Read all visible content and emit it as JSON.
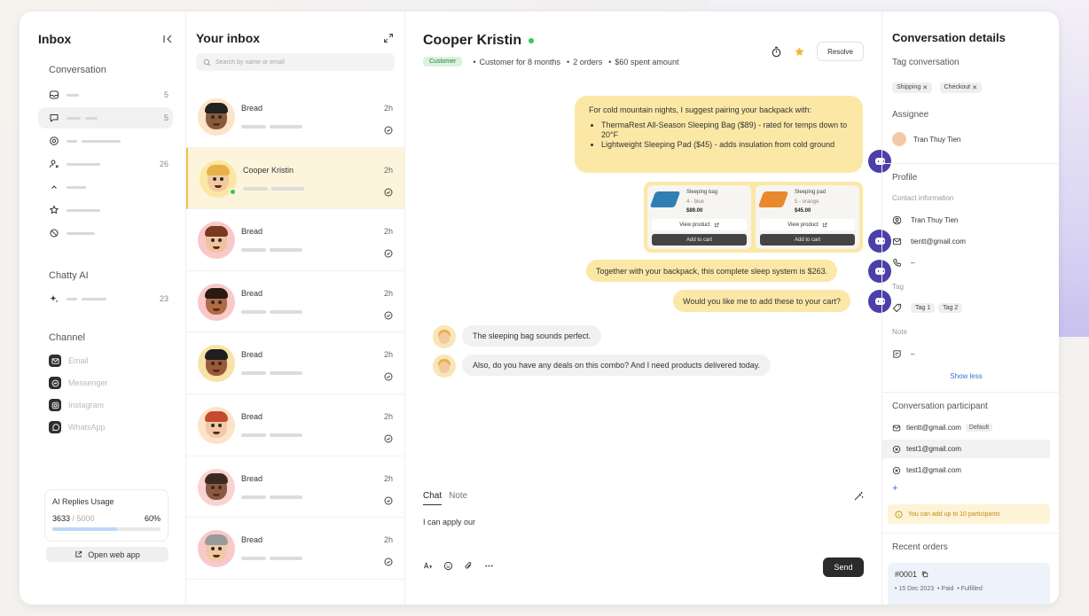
{
  "colors": {
    "accent_yellow": "#fbe8a6",
    "selected_row": "#fdf4dc",
    "online_green": "#34c759",
    "bot_purple": "#4b3fa8",
    "customer_badge": "#d9f3de",
    "usage_fill": "#b9d8f4"
  },
  "sidebar": {
    "title": "Inbox",
    "collapse_icon": "collapse-left-icon",
    "conversation_section": "Conversation",
    "conversation_items": [
      {
        "icon": "inbox-icon",
        "count": "5"
      },
      {
        "icon": "chat-bubble-icon",
        "count": "5"
      },
      {
        "icon": "at-icon",
        "count": ""
      },
      {
        "icon": "user-x-icon",
        "count": "26"
      },
      {
        "icon": "chevron-up-icon",
        "count": ""
      },
      {
        "icon": "star-icon",
        "count": ""
      },
      {
        "icon": "ban-icon",
        "count": ""
      }
    ],
    "ai_section": "Chatty AI",
    "ai_items": [
      {
        "icon": "sparkle-icon",
        "count": "23"
      }
    ],
    "channel_section": "Channel",
    "channels": [
      {
        "label": "Email",
        "icon": "email-icon"
      },
      {
        "label": "Messenger",
        "icon": "messenger-icon"
      },
      {
        "label": "Instagram",
        "icon": "instagram-icon"
      },
      {
        "label": "WhatsApp",
        "icon": "whatsapp-icon"
      }
    ],
    "usage": {
      "title": "AI Replies Usage",
      "used": "3633",
      "total": "/ 5000",
      "percent": "60%",
      "fraction": 0.6
    },
    "open_web_app": "Open web app"
  },
  "inbox": {
    "title": "Your inbox",
    "search_placeholder": "Search by name or email",
    "conversations": [
      {
        "name": "Bread",
        "time": "2h",
        "skin": "#8a5a3c",
        "hair": "#222222",
        "bg": "#fde3c8",
        "selected": false
      },
      {
        "name": "Cooper Kristin",
        "time": "2h",
        "skin": "#f3c9a0",
        "hair": "#e8b04a",
        "bg": "#fbe7a4",
        "selected": true
      },
      {
        "name": "Bread",
        "time": "2h",
        "skin": "#f1c2a0",
        "hair": "#7a3a1f",
        "bg": "#f9c9c9",
        "selected": false
      },
      {
        "name": "Bread",
        "time": "2h",
        "skin": "#b06a45",
        "hair": "#2a1a12",
        "bg": "#f9c9c9",
        "selected": false
      },
      {
        "name": "Bread",
        "time": "2h",
        "skin": "#9a5a38",
        "hair": "#1f1f1f",
        "bg": "#f7e3a8",
        "selected": false
      },
      {
        "name": "Bread",
        "time": "2h",
        "skin": "#f1c9a4",
        "hair": "#c64a2e",
        "bg": "#fde3c8",
        "selected": false
      },
      {
        "name": "Bread",
        "time": "2h",
        "skin": "#8b5a3e",
        "hair": "#3a2a22",
        "bg": "#f9d3d3",
        "selected": false
      },
      {
        "name": "Bread",
        "time": "2h",
        "skin": "#f1c9a4",
        "hair": "#9a9a9a",
        "bg": "#f9c9c9",
        "selected": false
      }
    ]
  },
  "chat": {
    "name": "Cooper Kristin",
    "tag": "Customer",
    "meta": [
      "Customer for 8 months",
      "2 orders",
      "$60 spent amount"
    ],
    "resolve": "Resolve",
    "messages": {
      "m1_intro": "For cold mountain nights, I suggest pairing your backpack with:",
      "m1_b1": "ThermaRest All-Season Sleeping Bag ($89) - rated for temps down to 20°F",
      "m1_b2": "Lightweight Sleeping Pad ($45) - adds insulation from cold ground",
      "m2": "Together with your backpack, this complete sleep system is $263.",
      "m3": "Would you like me to add these to your cart?",
      "m4": "The sleeping bag sounds perfect.",
      "m5": "Also, do you have any deals on this combo? And I need products delivered today."
    },
    "products": [
      {
        "name": "Sleeping bag",
        "variant": "4 - blue",
        "price": "$89.00",
        "color": "#2f7fb3",
        "view": "View product",
        "add": "Add to cart"
      },
      {
        "name": "Sleeping pad",
        "variant": "5 - orange",
        "price": "$45.00",
        "color": "#e8892c",
        "view": "View product",
        "add": "Add to cart"
      }
    ],
    "composer": {
      "tab_chat": "Chat",
      "tab_note": "Note",
      "text": "I can apply our",
      "send": "Send"
    }
  },
  "details": {
    "title": "Conversation details",
    "tag_section": "Tag conversation",
    "tags": [
      "Shipping",
      "Checkout"
    ],
    "assignee_section": "Assignee",
    "assignee": "Tran Thuy Tien",
    "profile_section": "Profile",
    "contact_info": "Contact information",
    "contact_name": "Tran Thuy Tien",
    "contact_email": "tientt@gmail.com",
    "contact_phone": "–",
    "tag_label": "Tag",
    "profile_tags": [
      "Tag 1",
      "Tag 2"
    ],
    "note_label": "Note",
    "note_value": "–",
    "show_less": "Show less",
    "participant_section": "Conversation participant",
    "participants": [
      {
        "email": "tientt@gmail.com",
        "badge": "Default"
      },
      {
        "email": "test1@gmail.com",
        "badge": ""
      },
      {
        "email": "test1@gmail.com",
        "badge": ""
      }
    ],
    "add_participant": "+",
    "participant_note": "You can add up to 10 participants",
    "orders_section": "Recent orders",
    "order": {
      "number": "#0001",
      "date": "15 Dec 2023",
      "paid": "Paid",
      "fulfilled": "Fulfilled"
    }
  }
}
